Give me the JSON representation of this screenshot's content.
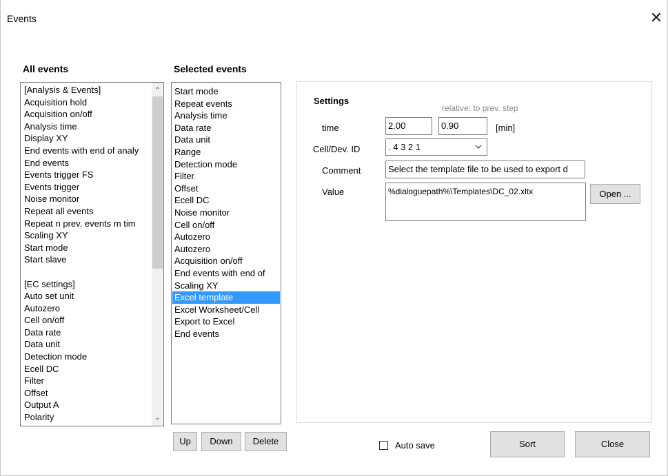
{
  "window": {
    "title": "Events",
    "close_glyph": "✕"
  },
  "all_events": {
    "heading": "All events",
    "items": [
      "[Analysis & Events]",
      "Acquisition hold",
      "Acquisition on/off",
      "Analysis time",
      "Display XY",
      "End events with end of analy",
      "End events",
      "Events trigger FS",
      "Events trigger",
      "Noise monitor",
      "Repeat all events",
      "Repeat n prev. events m tim",
      "Scaling XY",
      "Start mode",
      "Start slave",
      "",
      "[EC settings]",
      "Auto set unit",
      "Autozero",
      "Cell on/off",
      "Data rate",
      "Data unit",
      "Detection mode",
      "Ecell DC",
      "Filter",
      "Offset",
      "Output A",
      "Polarity"
    ],
    "scroll_up": "⌃",
    "scroll_down": "⌄"
  },
  "selected_events": {
    "heading": "Selected events",
    "items": [
      "Start mode",
      "Repeat events",
      "Analysis time",
      "Data rate",
      "Data unit",
      "Range",
      "Detection mode",
      "Filter",
      "Offset",
      "Ecell DC",
      "Noise monitor",
      "Cell on/off",
      "Autozero",
      "Autozero",
      "Acquisition on/off",
      "End events with end of",
      "Scaling XY",
      "Excel template",
      "Excel Worksheet/Cell",
      "Export to Excel",
      "End events"
    ],
    "selected_index": 17,
    "buttons": {
      "up": "Up",
      "down": "Down",
      "delete": "Delete"
    }
  },
  "settings": {
    "heading": "Settings",
    "relative_note": "relative: to prev. step",
    "time_label": "time",
    "time_value": "2.00",
    "time_relative_value": "0.90",
    "time_unit": "[min]",
    "cell_label": "Cell/Dev. ID",
    "cell_value": ". 4 3 2 1",
    "comment_label": "Comment",
    "comment_value": "Select the template file to be used to export d",
    "value_label": "Value",
    "value_text": "%dialoguepath%\\Templates\\DC_02.xltx",
    "open_button": "Open ..."
  },
  "footer": {
    "auto_save_label": "Auto save",
    "auto_save_checked": false,
    "sort_button": "Sort",
    "close_button": "Close"
  },
  "icons": {
    "dropdown": "chevron-down-icon",
    "close": "close-icon"
  },
  "colors": {
    "selection": "#3399ff",
    "button_face": "#e1e1e1"
  }
}
